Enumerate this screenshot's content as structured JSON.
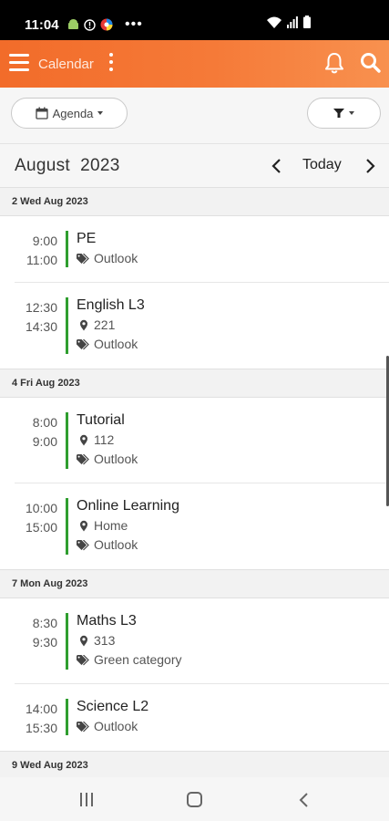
{
  "status_bar": {
    "time": "11:04",
    "more": "•••"
  },
  "app_bar": {
    "title": "Calendar"
  },
  "toolbar": {
    "view_label": "Agenda"
  },
  "month_nav": {
    "month": "August",
    "year": "2023",
    "today_label": "Today"
  },
  "days": [
    {
      "header": "2 Wed Aug 2023",
      "events": [
        {
          "start": "9:00",
          "end": "11:00",
          "title": "PE",
          "category": "Outlook"
        },
        {
          "start": "12:30",
          "end": "14:30",
          "title": "English L3",
          "location": "221",
          "category": "Outlook"
        }
      ]
    },
    {
      "header": "4 Fri Aug 2023",
      "events": [
        {
          "start": "8:00",
          "end": "9:00",
          "title": "Tutorial",
          "location": "112",
          "category": "Outlook"
        },
        {
          "start": "10:00",
          "end": "15:00",
          "title": "Online Learning",
          "location": "Home",
          "category": "Outlook"
        }
      ]
    },
    {
      "header": "7 Mon Aug 2023",
      "events": [
        {
          "start": "8:30",
          "end": "9:30",
          "title": "Maths L3",
          "location": "313",
          "category": "Green category"
        },
        {
          "start": "14:00",
          "end": "15:30",
          "title": "Science L2",
          "category": "Outlook"
        }
      ]
    },
    {
      "header": "9 Wed Aug 2023"
    }
  ],
  "colors": {
    "accent": "#f26c2a",
    "event_bar": "#2f9e2f"
  }
}
